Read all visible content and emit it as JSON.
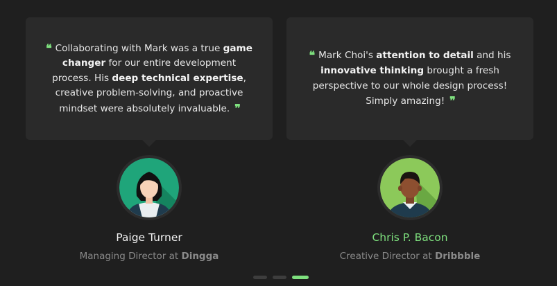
{
  "colors": {
    "background": "#1f1f1f",
    "card": "#2a2a2a",
    "accent": "#7ee07e",
    "muted": "#8a8a8a"
  },
  "quote_marks": {
    "open": "❝",
    "close": "❞",
    "open_icon": "open-quote-icon",
    "close_icon": "close-quote-icon"
  },
  "testimonials": [
    {
      "quote_parts": [
        "Collaborating with Mark was a true ",
        "game changer",
        " for our entire development process. His ",
        "deep technical expertise",
        ", creative problem-solving, and proactive mindset were absolutely invaluable."
      ],
      "name": "Paige Turner",
      "role_prefix": "Managing Director at ",
      "company": "Dingga",
      "avatar_icon": "woman-avatar-icon",
      "avatar_bg": "#1fa57a",
      "active": false
    },
    {
      "quote_parts": [
        "Mark Choi's ",
        "attention to detail",
        " and his ",
        "innovative thinking",
        " brought a fresh perspective to our whole design process! Simply amazing!"
      ],
      "name": "Chris P. Bacon",
      "role_prefix": "Creative Director at ",
      "company": "Dribbble",
      "avatar_icon": "man-avatar-icon",
      "avatar_bg": "#8cc95a",
      "active": true
    }
  ],
  "pagination": {
    "total": 3,
    "active_index": 2
  }
}
